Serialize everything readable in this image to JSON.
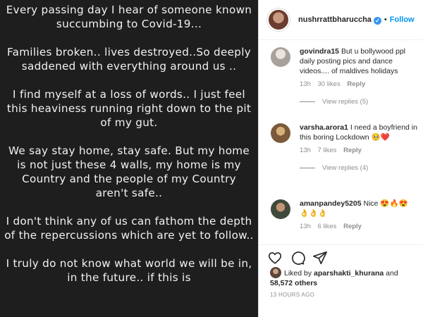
{
  "post_text": {
    "p1": "Every passing day I hear of someone known succumbing to Covid-19...",
    "p2": "Families broken.. lives destroyed..So deeply saddened with everything around us ..",
    "p3": "I find myself at a loss of words.. I just feel this heaviness running right down to the pit of my gut.",
    "p4": "We say stay home, stay safe. But my home is not just these 4 walls, my home is my Country and the people of my Country aren't safe..",
    "p5": "I don't think any of us can fathom the depth of the repercussions which are yet to follow..",
    "p6": "I truly do not know what world we will be in, in the future.. if this is"
  },
  "header": {
    "username": "nushrrattbharuccha",
    "dot": "•",
    "follow_label": "Follow"
  },
  "comments": [
    {
      "username": "govindra15",
      "text": "But u bollywood ppl daily posting pics and dance videos.... of maldives holidays",
      "time": "13h",
      "likes": "30 likes",
      "reply": "Reply",
      "view_replies": "View replies (5)"
    },
    {
      "username": "varsha.arora1",
      "text": "I need a boyfriend in this boring Lockdown 🥺❤️",
      "time": "13h",
      "likes": "7 likes",
      "reply": "Reply",
      "view_replies": "View replies (4)"
    },
    {
      "username": "amanpandey5205",
      "text": "Nice 😍🔥😍 👌👌👌",
      "time": "13h",
      "likes": "6 likes",
      "reply": "Reply"
    }
  ],
  "likes": {
    "prefix": "Liked by",
    "first_user": "aparshakti_khurana",
    "connector": "and",
    "others": "58,572 others"
  },
  "timestamp": "13 HOURS AGO",
  "icons": {
    "verified": "verified-badge-icon",
    "heart": "heart-icon",
    "comment": "comment-icon",
    "share": "share-icon"
  },
  "colors": {
    "accent": "#0095f6",
    "post_bg": "#1e1e1e",
    "muted": "#8e8e8e"
  }
}
